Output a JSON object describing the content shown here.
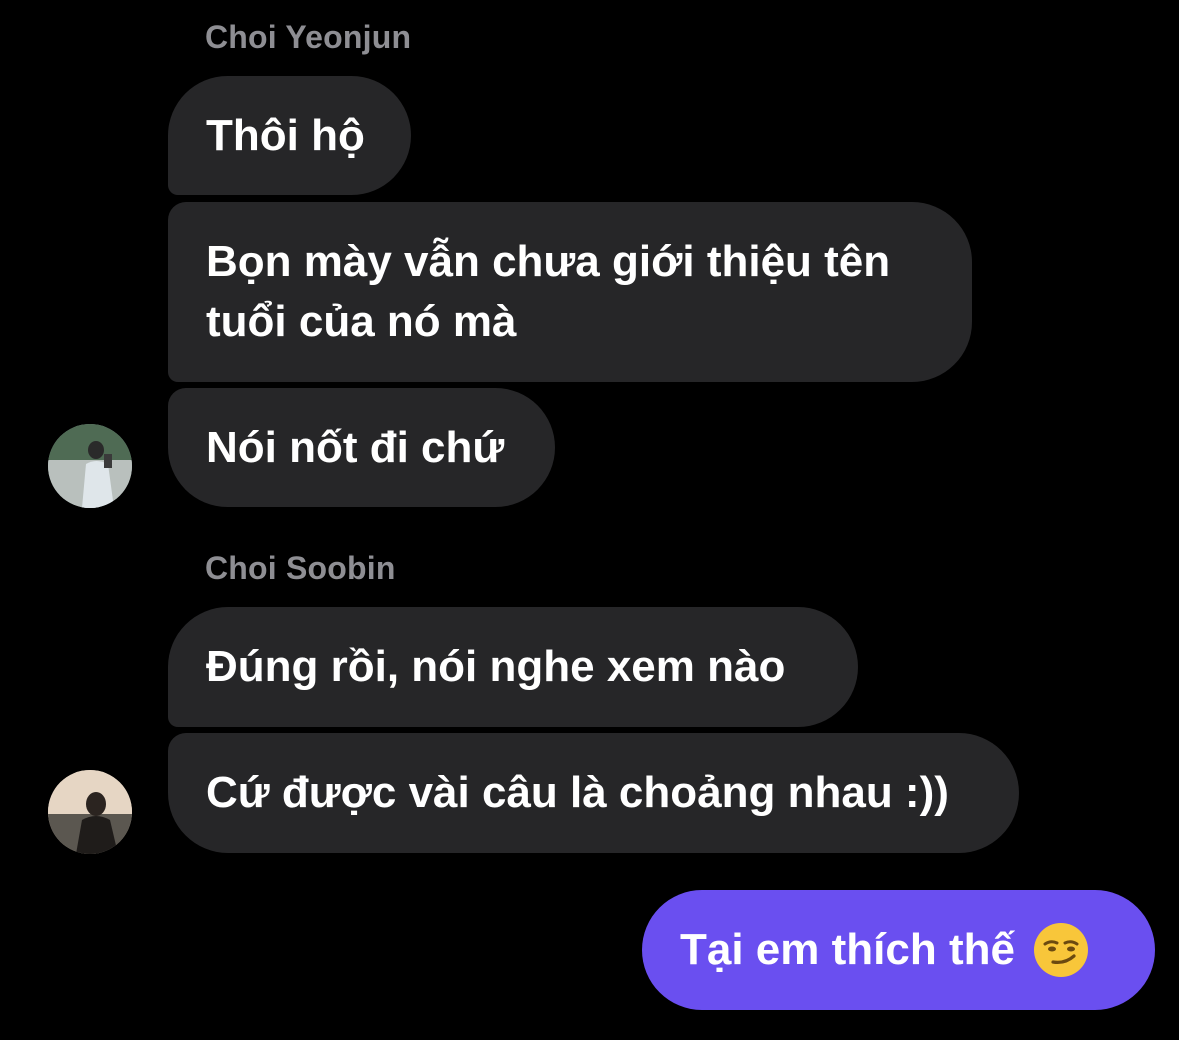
{
  "chat": {
    "groups": [
      {
        "sender": "Choi Yeonjun",
        "messages": [
          "Thôi hộ",
          "Bọn mày vẫn chưa giới thiệu tên tuổi của nó mà",
          "Nói nốt đi chứ"
        ]
      },
      {
        "sender": "Choi Soobin",
        "messages": [
          "Đúng rồi, nói nghe xem nào",
          "Cứ được vài câu là choảng nhau :))"
        ]
      }
    ],
    "outgoing": {
      "text": "Tại em thích thế",
      "emoji": "smirking-face-icon"
    }
  },
  "colors": {
    "background": "#000000",
    "incoming_bubble": "#262628",
    "outgoing_bubble": "#6a4ff0",
    "sender_name": "#8e8e93",
    "text": "#ffffff"
  }
}
